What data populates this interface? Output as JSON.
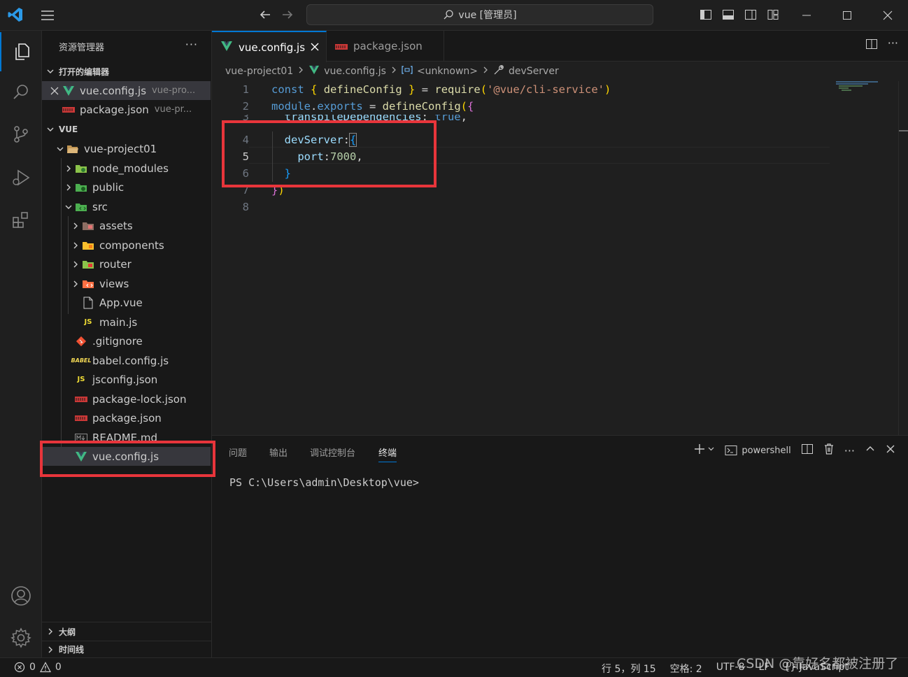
{
  "titlebar": {
    "search_text": "vue [管理员]"
  },
  "sidebar": {
    "title": "资源管理器",
    "more": "···",
    "open_editors_title": "打开的编辑器",
    "open_editors": [
      {
        "name": "vue.config.js",
        "desc": "vue-pro..."
      },
      {
        "name": "package.json",
        "desc": "vue-pr..."
      }
    ],
    "workspace_title": "VUE",
    "tree": {
      "project": "vue-project01",
      "node_modules": "node_modules",
      "public": "public",
      "src": "src",
      "assets": "assets",
      "components": "components",
      "router": "router",
      "views": "views",
      "app_vue": "App.vue",
      "main_js": "main.js",
      "gitignore": ".gitignore",
      "babel": "babel.config.js",
      "jsconfig": "jsconfig.json",
      "package_lock": "package-lock.json",
      "package": "package.json",
      "readme": "README.md",
      "vue_config": "vue.config.js"
    },
    "outline_title": "大纲",
    "timeline_title": "时间线"
  },
  "tabs": [
    {
      "label": "vue.config.js",
      "active": true
    },
    {
      "label": "package.json",
      "active": false
    }
  ],
  "breadcrumb": {
    "project": "vue-project01",
    "file": "vue.config.js",
    "symbol1": "<unknown>",
    "symbol2": "devServer"
  },
  "editor": {
    "line_numbers": [
      "1",
      "2",
      "3",
      "4",
      "5",
      "6",
      "7",
      "8"
    ],
    "l1": {
      "a": "const",
      "b": " ",
      "c": "{",
      "d": " defineConfig ",
      "e": "}",
      "f": " = ",
      "g": "require",
      "h": "(",
      "i": "'@vue/cli-service'",
      "j": ")"
    },
    "l2": {
      "a": "module",
      "b": ".",
      "c": "exports",
      "d": " = ",
      "e": "defineConfig",
      "f": "(",
      "g": "{"
    },
    "l3": {
      "a": "  transpileDependencies",
      "b": ": ",
      "c": "true",
      "d": ","
    },
    "l4": {
      "a": "  devServer",
      "b": ":",
      "c": "{"
    },
    "l5": {
      "a": "    port",
      "b": ":",
      "c": "7000",
      "d": ","
    },
    "l6": {
      "a": "  }"
    },
    "l7": {
      "a": "}",
      "b": ")"
    }
  },
  "panel": {
    "tabs": [
      "问题",
      "输出",
      "调试控制台",
      "终端"
    ],
    "shell": "powershell",
    "prompt": "PS C:\\Users\\admin\\Desktop\\vue>"
  },
  "statusbar": {
    "errors": "0",
    "warnings": "0",
    "position": "行 5，列 15",
    "spaces": "空格: 2",
    "encoding": "UTF-8",
    "eol": "LF",
    "language": "{} JavaScript"
  },
  "watermark": "CSDN @靠好名都被注册了",
  "colors": {
    "accent": "#0078d4",
    "highlight": "#e8353b"
  }
}
